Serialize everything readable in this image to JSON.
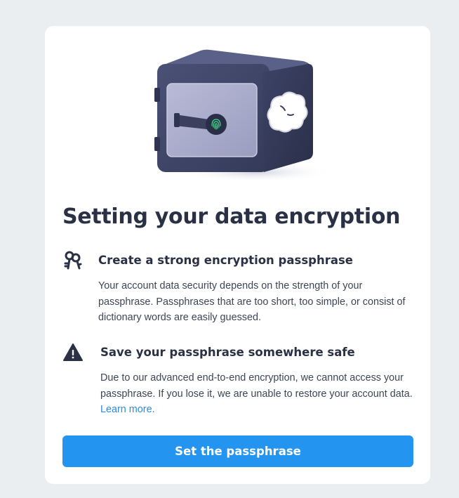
{
  "dialog": {
    "title": "Setting your data encryption",
    "sections": [
      {
        "icon": "keys-icon",
        "heading": "Create a strong encryption passphrase",
        "body": "Your account data security depends on the strength of your passphrase. Passphrases that are too short, too simple, or consist of dictionary words are easily guessed."
      },
      {
        "icon": "warning-triangle-icon",
        "heading": "Save your passphrase somewhere safe",
        "body": "Due to our advanced end-to-end encryption, we cannot access your passphrase. If you lose it, we are unable to restore your account data.",
        "link": "Learn more."
      }
    ],
    "primary_button": "Set the passphrase"
  },
  "colors": {
    "page_background": "#ebeef0",
    "card_background": "#ffffff",
    "text_primary": "#2a3145",
    "text_body": "#3e4556",
    "link": "#2b8ae8",
    "button": "#2395f0",
    "safe_body": "#3a4060",
    "fingerprint": "#3de08a"
  }
}
